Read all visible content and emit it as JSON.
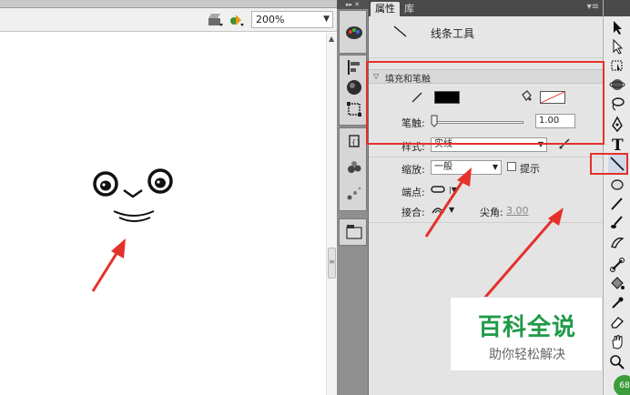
{
  "stage": {
    "zoom_value": "200%",
    "icons": [
      "edit-scene-icon",
      "edit-symbol-icon"
    ]
  },
  "panel": {
    "tabs": [
      {
        "label": "属性",
        "active": true
      },
      {
        "label": "库",
        "active": false
      }
    ],
    "tool_name": "线条工具",
    "section_title": "填充和笔触",
    "stroke_color": "#000000",
    "fill_color": "none",
    "stroke_label": "笔触:",
    "stroke_value": "1.00",
    "style_label": "样式:",
    "style_value": "实线",
    "scale_label": "缩放:",
    "scale_value": "一般",
    "hint_label": "提示",
    "cap_label": "端点:",
    "join_label": "接合:",
    "miter_label": "尖角:",
    "miter_value": "3.00"
  },
  "dock_icons": [
    "color-icon",
    "align-icon",
    "info-icon",
    "transform-icon",
    "components-icon",
    "movie-explorer-icon",
    "library-icon"
  ],
  "tools_icons": [
    "selection-tool-icon",
    "subselection-tool-icon",
    "free-transform-icon",
    "3d-rotation-icon",
    "lasso-icon",
    "pen-icon",
    "text-icon",
    "line-tool-icon",
    "rectangle-tool-icon",
    "pencil-icon",
    "brush-icon",
    "deco-icon",
    "bone-icon",
    "paint-bucket-icon",
    "eyedropper-icon",
    "eraser-icon",
    "hand-icon",
    "zoom-icon"
  ],
  "badge_text": "68",
  "watermark": {
    "main": "百科全说",
    "sub": "助你轻松解决"
  },
  "colors": {
    "highlight_red": "#e4312b",
    "watermark_green": "#1f9a47"
  }
}
